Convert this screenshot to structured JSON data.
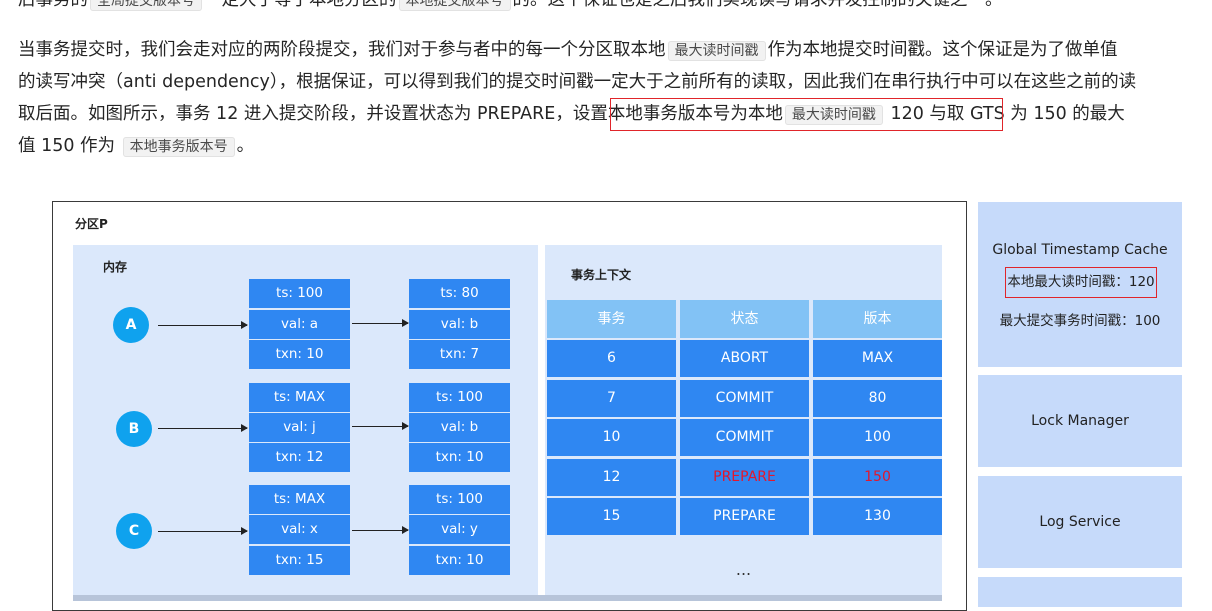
{
  "article": {
    "line0": [
      "后事务的",
      "全局提交版本号",
      "一定大于等于本地分区的",
      "本地提交版本号",
      "的。这个保证也是之后我们实现读写请求并发控制的关键之一。"
    ],
    "line1": [
      "当事务提交时，我们会走对应的两阶段提交，我们对于参与者中的每一个分区取本地",
      "最大读时间戳",
      "作为本地提交时间戳。这个保证是为了做单值"
    ],
    "line2": "的读写冲突（anti dependency），根据保证，可以得到我们的提交时间戳一定大于之前所有的读取，因此我们在串行执行中可以在这些之前的读",
    "line3": [
      "取后面。如图所示，事务 12 进入提交阶段，并设置状态为 PREPARE，",
      "设置本地事务版本号为本地",
      "最大读时间戳",
      "120",
      "与取 GTS 为 150 的最大"
    ],
    "line4": [
      "值 150 作为",
      "本地事务版本号",
      "。"
    ]
  },
  "figure": {
    "partition_title": "分区P",
    "memory_title": "内存",
    "context_title": "事务上下文",
    "nodes": [
      "A",
      "B",
      "C"
    ],
    "records": [
      {
        "first": [
          "ts: 100",
          "val: a",
          "txn: 10"
        ],
        "second": [
          "ts: 80",
          "val: b",
          "txn: 7"
        ]
      },
      {
        "first": [
          "ts: MAX",
          "val: j",
          "txn: 12"
        ],
        "second": [
          "ts: 100",
          "val: b",
          "txn: 10"
        ]
      },
      {
        "first": [
          "ts: MAX",
          "val: x",
          "txn: 15"
        ],
        "second": [
          "ts: 100",
          "val: y",
          "txn: 10"
        ]
      }
    ],
    "table": {
      "headers": [
        "事务",
        "状态",
        "版本"
      ],
      "rows": [
        [
          "6",
          "ABORT",
          "MAX"
        ],
        [
          "7",
          "COMMIT",
          "80"
        ],
        [
          "10",
          "COMMIT",
          "100"
        ],
        [
          "12",
          "PREPARE",
          "150"
        ],
        [
          "15",
          "PREPARE",
          "130"
        ]
      ],
      "highlight_color": "#e3172d",
      "ellipsis": "..."
    },
    "side": {
      "cache_title": "Global Timestamp Cache",
      "max_read": "本地最大读时间戳：120",
      "max_commit": "最大提交事务时间戳：100",
      "lock_manager": "Lock Manager",
      "log_service": "Log Service"
    }
  }
}
